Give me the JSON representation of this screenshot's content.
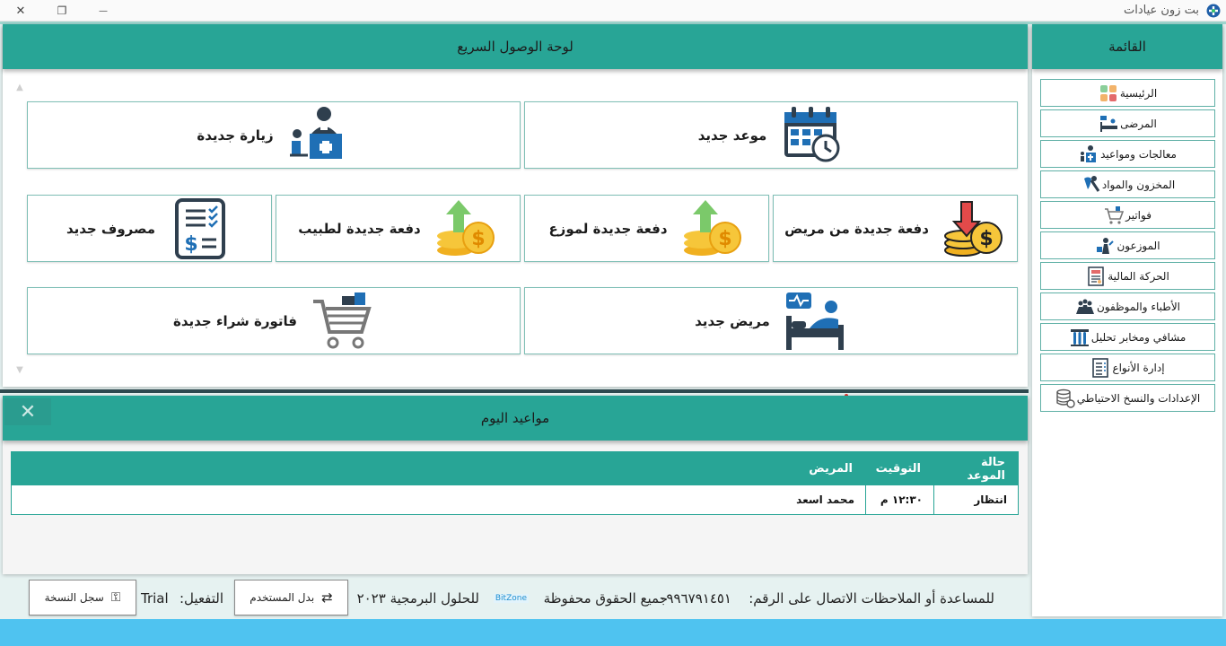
{
  "window": {
    "title": "بت زون عيادات",
    "minimize_glyph": "—",
    "restore_glyph": "❐",
    "close_glyph": "✕"
  },
  "quick_access": {
    "title": "لوحة الوصول السريع",
    "tiles": [
      {
        "label": "موعد جديد",
        "icon": "calendar-clock-icon"
      },
      {
        "label": "زيارة جديدة",
        "icon": "doctor-desk-icon"
      },
      {
        "label": "دفعة جديدة من مريض",
        "icon": "coins-down-icon"
      },
      {
        "label": "دفعة جديدة لموزع",
        "icon": "coins-up-icon"
      },
      {
        "label": "دفعة جديدة لطبيب",
        "icon": "coins-up-icon"
      },
      {
        "label": "مصروف جديد",
        "icon": "expense-list-icon"
      },
      {
        "label": "مريض جديد",
        "icon": "patient-bed-icon"
      },
      {
        "label": "فاتورة شراء جديدة",
        "icon": "shopping-cart-icon"
      }
    ]
  },
  "sidebar": {
    "title": "القائمة",
    "items": [
      {
        "label": "الرئيسية",
        "icon": "home-tiles-icon"
      },
      {
        "label": "المرضى",
        "icon": "patient-bed-icon"
      },
      {
        "label": "معالجات ومواعيد",
        "icon": "doctor-icon"
      },
      {
        "label": "المخزون والمواد",
        "icon": "tooth-tools-icon"
      },
      {
        "label": "فواتير",
        "icon": "cart-icon"
      },
      {
        "label": "الموزعون",
        "icon": "distributor-icon"
      },
      {
        "label": "الحركة المالية",
        "icon": "finance-report-icon"
      },
      {
        "label": "الأطباء والموظفون",
        "icon": "staff-group-icon"
      },
      {
        "label": "مشافي ومخابر تحليل",
        "icon": "test-tubes-icon"
      },
      {
        "label": "إدارة الأنواع",
        "icon": "checklist-icon"
      },
      {
        "label": "الإعدادات والنسخ الاحتياطي",
        "icon": "database-settings-icon"
      }
    ]
  },
  "appointments": {
    "title": "مواعيد اليوم",
    "close_glyph": "✕",
    "columns": [
      "حالة الموعد",
      "التوقيت",
      "المريض"
    ],
    "rows": [
      {
        "status": "انتظار",
        "time": "١٢:٣٠ م",
        "patient": "محمد اسعد"
      }
    ]
  },
  "footer": {
    "help_text": "للمساعدة أو الملاحظات الاتصال على الرقم:",
    "phone": "٠٩٩٦٧٩١٤٥١",
    "rights": "جميع الحقوق محفوظة",
    "company_prefix": "للحلول البرمجية ٢٠٢٣",
    "company_logo": "BitZone",
    "switch_user_label": "بدل المستخدم",
    "activation_label": "التفعيل:",
    "activation_value": "Trial",
    "register_label": "سجل النسخة"
  },
  "colors": {
    "header": "#28a596",
    "tile_border": "#7fbfb6",
    "bottom_bar": "#4fc3f0"
  }
}
